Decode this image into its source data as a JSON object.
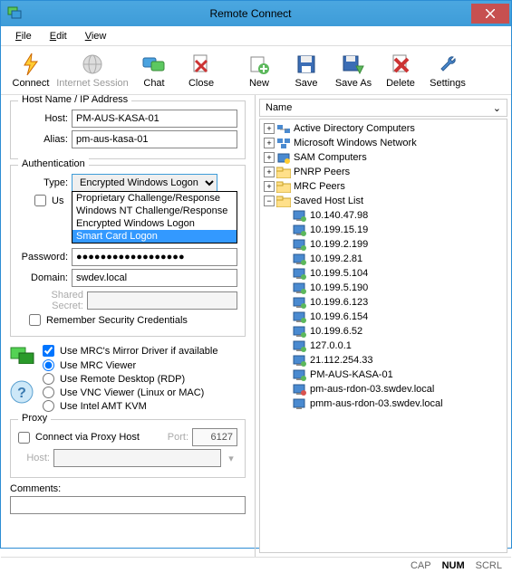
{
  "window": {
    "title": "Remote Connect"
  },
  "menu": {
    "file": "File",
    "edit": "Edit",
    "view": "View"
  },
  "toolbar": {
    "connect": "Connect",
    "internet": "Internet Session",
    "chat": "Chat",
    "close": "Close",
    "new": "New",
    "save": "Save",
    "saveas": "Save As",
    "delete": "Delete",
    "settings": "Settings"
  },
  "hostgroup": {
    "legend": "Host Name / IP Address",
    "host_label": "Host:",
    "host_value": "PM-AUS-KASA-01",
    "alias_label": "Alias:",
    "alias_value": "pm-aus-kasa-01"
  },
  "auth": {
    "legend": "Authentication",
    "type_label": "Type:",
    "type_value": "Encrypted Windows Logon",
    "options": [
      "Proprietary Challenge/Response",
      "Windows NT Challenge/Response",
      "Encrypted Windows Logon",
      "Smart Card Logon"
    ],
    "use_label": "Us",
    "pwd_label": "Password:",
    "pwd_value": "●●●●●●●●●●●●●●●●●●",
    "domain_label": "Domain:",
    "domain_value": "swdev.local",
    "secret_label": "Shared Secret:",
    "remember": "Remember Security Credentials"
  },
  "viewer": {
    "mirror": "Use MRC's Mirror Driver if available",
    "mrc": "Use MRC Viewer",
    "rdp": "Use Remote Desktop (RDP)",
    "vnc": "Use VNC Viewer (Linux or MAC)",
    "amt": "Use Intel AMT KVM"
  },
  "proxy": {
    "legend": "Proxy",
    "via": "Connect via Proxy Host",
    "port_label": "Port:",
    "port_value": "6127",
    "host_label": "Host:"
  },
  "comments": {
    "label": "Comments:",
    "value": ""
  },
  "tree": {
    "header": "Name",
    "roots": [
      {
        "label": "Active Directory Computers",
        "icon": "ad",
        "exp": "+"
      },
      {
        "label": "Microsoft Windows Network",
        "icon": "net",
        "exp": "+"
      },
      {
        "label": "SAM Computers",
        "icon": "sam",
        "exp": "+"
      },
      {
        "label": "PNRP Peers",
        "icon": "folder",
        "exp": "+"
      },
      {
        "label": "MRC Peers",
        "icon": "folder",
        "exp": "+"
      },
      {
        "label": "Saved Host List",
        "icon": "folder",
        "exp": "−"
      }
    ],
    "hosts": [
      {
        "label": "10.140.47.98",
        "status": "ok"
      },
      {
        "label": "10.199.15.19",
        "status": "ok"
      },
      {
        "label": "10.199.2.199",
        "status": "ok"
      },
      {
        "label": "10.199.2.81",
        "status": "ok"
      },
      {
        "label": "10.199.5.104",
        "status": "ok"
      },
      {
        "label": "10.199.5.190",
        "status": "ok"
      },
      {
        "label": "10.199.6.123",
        "status": "ok"
      },
      {
        "label": "10.199.6.154",
        "status": "ok"
      },
      {
        "label": "10.199.6.52",
        "status": "ok"
      },
      {
        "label": "127.0.0.1",
        "status": "ok"
      },
      {
        "label": "21.112.254.33",
        "status": "ok"
      },
      {
        "label": "PM-AUS-KASA-01",
        "status": "ok"
      },
      {
        "label": "pm-aus-rdon-03.swdev.local",
        "status": "err"
      },
      {
        "label": "pmm-aus-rdon-03.swdev.local",
        "status": "plain"
      }
    ]
  },
  "status": {
    "cap": "CAP",
    "num": "NUM",
    "scrl": "SCRL"
  }
}
